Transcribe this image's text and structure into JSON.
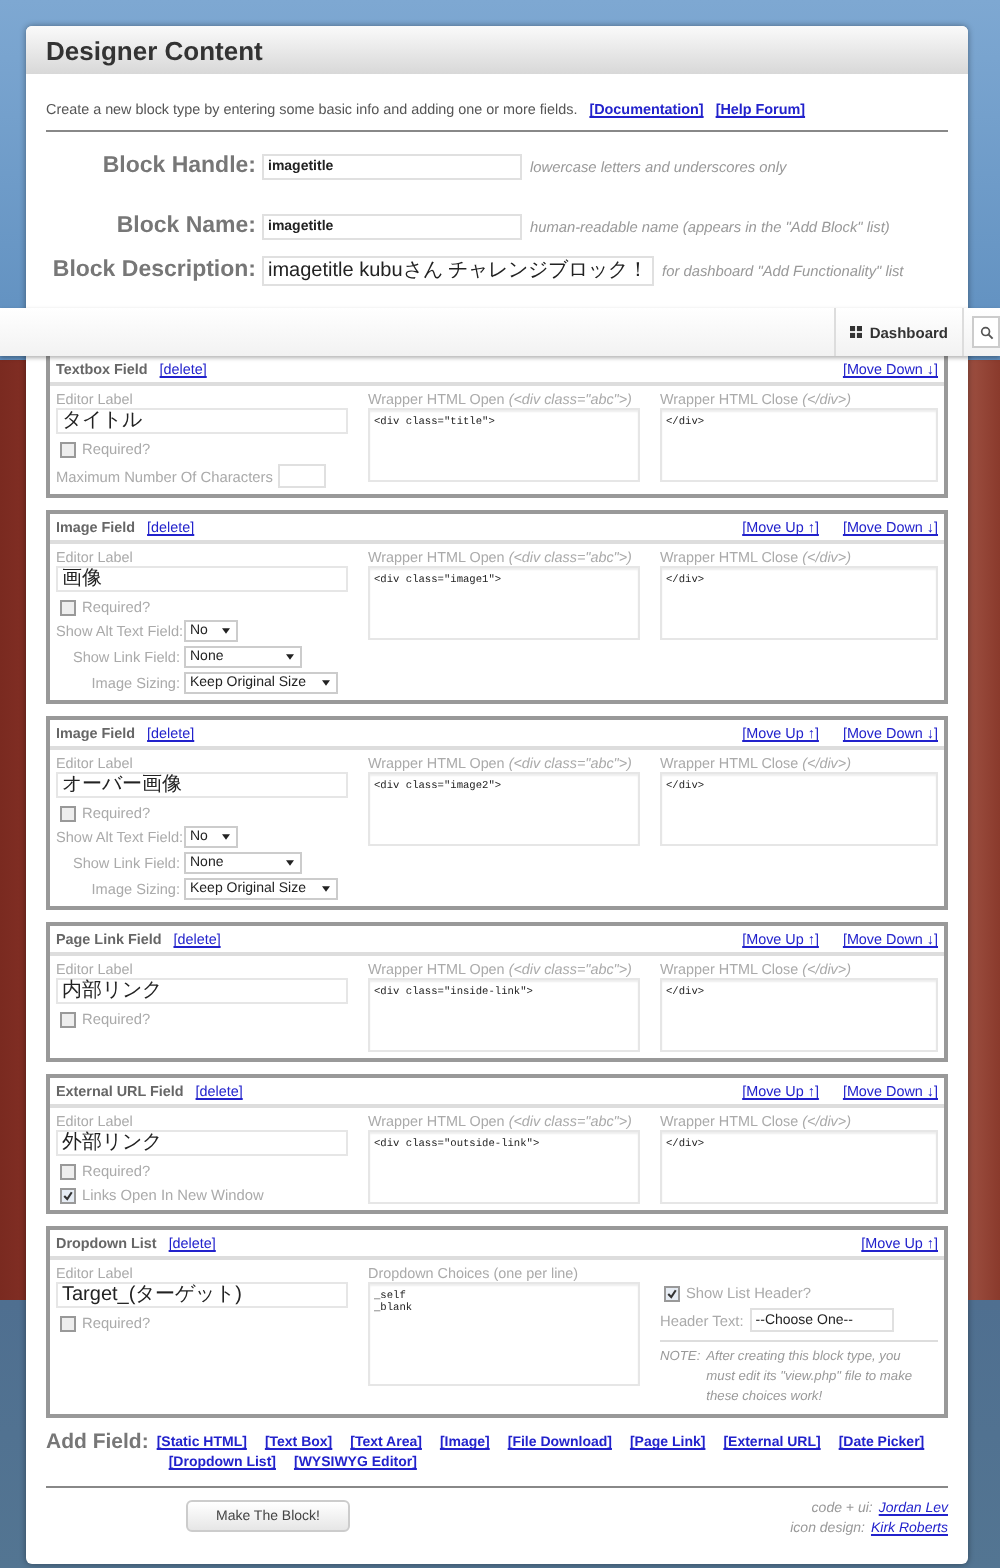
{
  "header": {
    "title": "Designer Content"
  },
  "intro": {
    "text": "Create a new block type by entering some basic info and adding one or more fields.",
    "links": [
      "[Documentation]",
      "[Help Forum]"
    ]
  },
  "block_fields": [
    {
      "label": "Block Handle:",
      "value": "imagetitle",
      "hint": "lowercase letters and underscores only"
    },
    {
      "label": "Block Name:",
      "value": "imagetitle",
      "hint": "human-readable name (appears in the \"Add Block\" list)"
    },
    {
      "label": "Block Description:",
      "value": "imagetitle kubuさん チャレンジブロック！",
      "hint": "for dashboard \"Add Functionality\" list"
    }
  ],
  "toolbar": {
    "dashboard": "Dashboard"
  },
  "fields": [
    {
      "kind": "textbox",
      "title": "Textbox Field",
      "delete": "[delete]",
      "moves": [
        "[Move Down ↓]"
      ],
      "editor_label": "Editor Label",
      "label_value": "タイトル",
      "required": {
        "label": "Required?",
        "checked": false
      },
      "wrapper_open": {
        "label": "Wrapper HTML Open",
        "hint": "(<div class=\"abc\">)",
        "value": "<div class=\"title\">"
      },
      "wrapper_close": {
        "label": "Wrapper HTML Close",
        "hint": "(</div>)",
        "value": "</div>"
      },
      "max_chars_label": "Maximum Number Of Characters"
    },
    {
      "kind": "image",
      "title": "Image Field",
      "delete": "[delete]",
      "moves": [
        "[Move Up ↑]",
        "[Move Down ↓]"
      ],
      "editor_label": "Editor Label",
      "label_value": "画像",
      "required": {
        "label": "Required?",
        "checked": false
      },
      "wrapper_open": {
        "label": "Wrapper HTML Open",
        "hint": "(<div class=\"abc\">)",
        "value": "<div class=\"image1\">"
      },
      "wrapper_close": {
        "label": "Wrapper HTML Close",
        "hint": "(</div>)",
        "value": "</div>"
      },
      "options": [
        {
          "label": "Show Alt Text Field:",
          "value": "No"
        },
        {
          "label": "Show Link Field:",
          "value": "None"
        },
        {
          "label": "Image Sizing:",
          "value": "Keep Original Size"
        }
      ]
    },
    {
      "kind": "image",
      "title": "Image Field",
      "delete": "[delete]",
      "moves": [
        "[Move Up ↑]",
        "[Move Down ↓]"
      ],
      "editor_label": "Editor Label",
      "label_value": "オーバー画像",
      "required": {
        "label": "Required?",
        "checked": false
      },
      "wrapper_open": {
        "label": "Wrapper HTML Open",
        "hint": "(<div class=\"abc\">)",
        "value": "<div class=\"image2\">"
      },
      "wrapper_close": {
        "label": "Wrapper HTML Close",
        "hint": "(</div>)",
        "value": "</div>"
      },
      "options": [
        {
          "label": "Show Alt Text Field:",
          "value": "No"
        },
        {
          "label": "Show Link Field:",
          "value": "None"
        },
        {
          "label": "Image Sizing:",
          "value": "Keep Original Size"
        }
      ]
    },
    {
      "kind": "page_link",
      "title": "Page Link Field",
      "delete": "[delete]",
      "moves": [
        "[Move Up ↑]",
        "[Move Down ↓]"
      ],
      "editor_label": "Editor Label",
      "label_value": "内部リンク",
      "required": {
        "label": "Required?",
        "checked": false
      },
      "wrapper_open": {
        "label": "Wrapper HTML Open",
        "hint": "(<div class=\"abc\">)",
        "value": "<div class=\"inside-link\">"
      },
      "wrapper_close": {
        "label": "Wrapper HTML Close",
        "hint": "(</div>)",
        "value": "</div>"
      }
    },
    {
      "kind": "external_url",
      "title": "External URL Field",
      "delete": "[delete]",
      "moves": [
        "[Move Up ↑]",
        "[Move Down ↓]"
      ],
      "editor_label": "Editor Label",
      "label_value": "外部リンク",
      "required": {
        "label": "Required?",
        "checked": false
      },
      "wrapper_open": {
        "label": "Wrapper HTML Open",
        "hint": "(<div class=\"abc\">)",
        "value": "<div class=\"outside-link\">"
      },
      "wrapper_close": {
        "label": "Wrapper HTML Close",
        "hint": "(</div>)",
        "value": "</div>"
      },
      "new_window": {
        "label": "Links Open In New Window",
        "checked": true
      }
    },
    {
      "kind": "dropdown",
      "title": "Dropdown List",
      "delete": "[delete]",
      "moves": [
        "[Move Up ↑]"
      ],
      "editor_label": "Editor Label",
      "label_value": "Target_(ターゲット)",
      "required": {
        "label": "Required?",
        "checked": false
      },
      "choices": {
        "label": "Dropdown Choices (one per line)",
        "value": "_self\n_blank"
      },
      "show_header": {
        "label": "Show List Header?",
        "checked": true
      },
      "header_text": {
        "label": "Header Text:",
        "value": "--Choose One--"
      },
      "note": {
        "label": "NOTE:",
        "text": "After creating this block type, you must edit its \"view.php\" file to make these choices work!"
      }
    }
  ],
  "add_field": {
    "label": "Add Field:",
    "links": [
      "[Static HTML]",
      "[Text Box]",
      "[Text Area]",
      "[Image]",
      "[File Download]",
      "[Page Link]",
      "[External URL]",
      "[Date Picker]",
      "[Dropdown List]",
      "[WYSIWYG Editor]"
    ]
  },
  "submit": "Make The Block!",
  "credits": [
    {
      "label": "code + ui:",
      "name": "Jordan Lev"
    },
    {
      "label": "icon design:",
      "name": "Kirk Roberts"
    }
  ]
}
